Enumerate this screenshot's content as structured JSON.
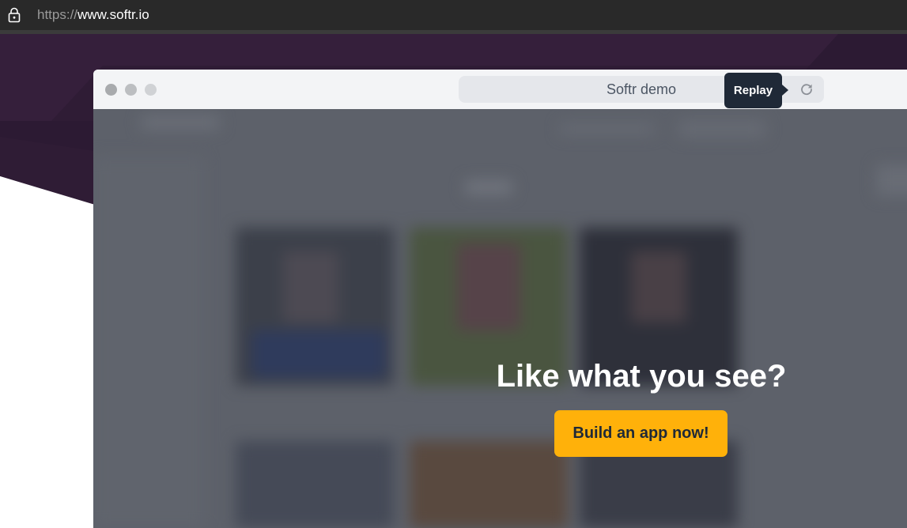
{
  "browser": {
    "url_scheme": "https://",
    "url_host": "www.softr.io",
    "lock_icon": "lock-icon"
  },
  "demo_window": {
    "address_title": "Softr demo",
    "replay_label": "Replay",
    "reload_icon": "reload-icon"
  },
  "overlay": {
    "headline": "Like what you see?",
    "cta_label": "Build an app now!"
  },
  "colors": {
    "browser_bar": "#292929",
    "hero_dark": "#2e1b33",
    "demo_overlay": "#5d616a",
    "cta": "#ffb10a",
    "tooltip": "#1f2937"
  }
}
